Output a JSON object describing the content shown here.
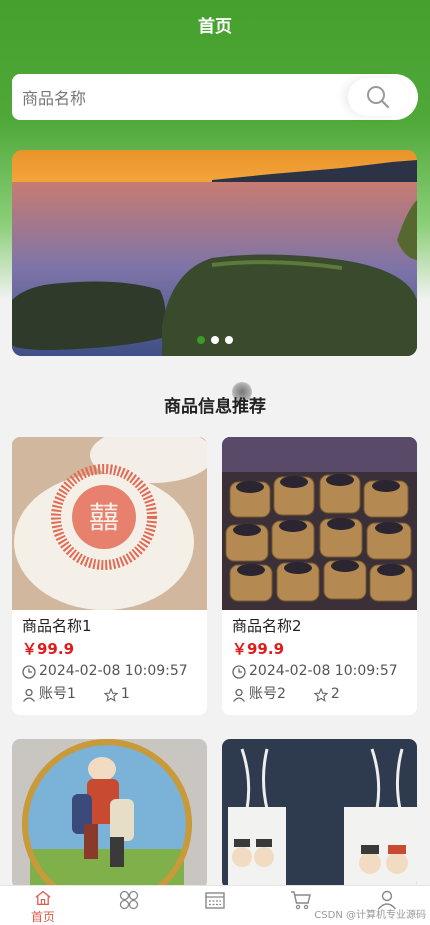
{
  "header": {
    "title": "首页"
  },
  "search": {
    "placeholder": "商品名称"
  },
  "banner": {
    "dots": 3,
    "active_index": 0
  },
  "section": {
    "title": "商品信息推荐"
  },
  "products": [
    {
      "name": "商品名称1",
      "price": "￥99.9",
      "time": "2024-02-08 10:09:57",
      "account": "账号1",
      "stars": "1"
    },
    {
      "name": "商品名称2",
      "price": "￥99.9",
      "time": "2024-02-08 10:09:57",
      "account": "账号2",
      "stars": "2"
    }
  ],
  "tabbar": {
    "items": [
      {
        "label": "首页",
        "icon": "home-icon",
        "active": true
      },
      {
        "label": "",
        "icon": "grid-icon"
      },
      {
        "label": "",
        "icon": "list-icon"
      },
      {
        "label": "",
        "icon": "cart-icon"
      },
      {
        "label": "",
        "icon": "user-icon"
      }
    ]
  },
  "watermark": "CSDN @计算机专业源码",
  "colors": {
    "brand_green": "#46a02d",
    "price_red": "#e21a1a",
    "active_tab": "#e05a4a"
  }
}
